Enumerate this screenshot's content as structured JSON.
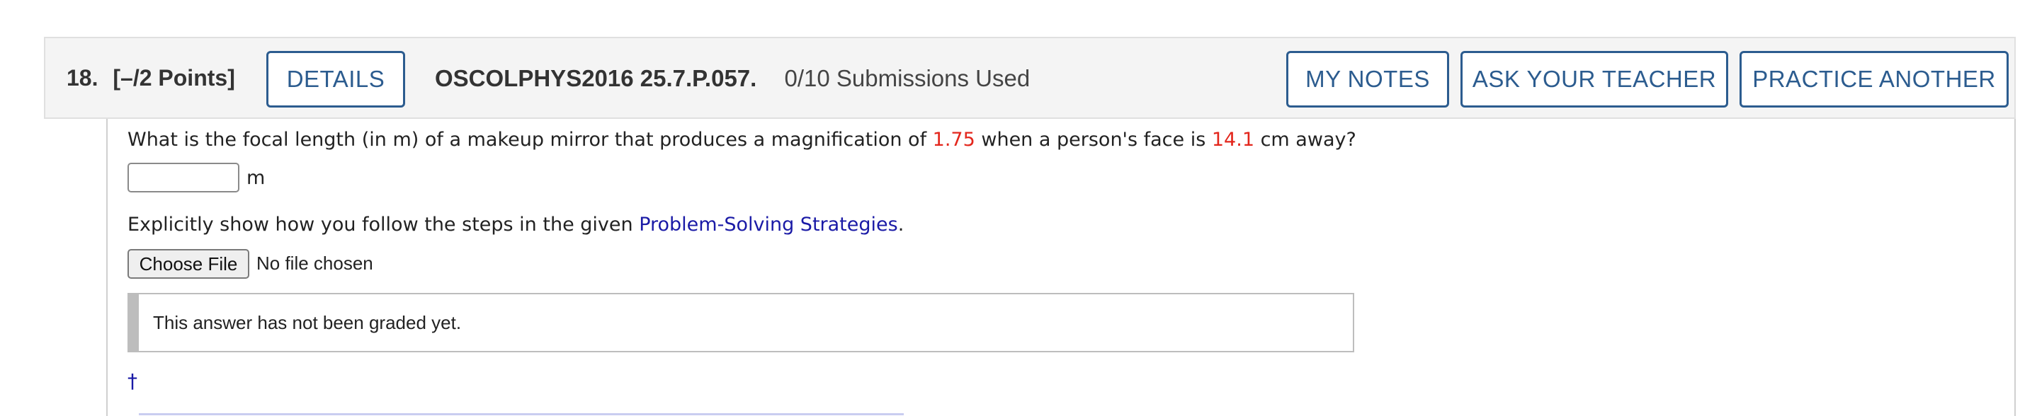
{
  "header": {
    "question_number": "18.",
    "points": "[–/2 Points]",
    "details_label": "DETAILS",
    "question_code": "OSCOLPHYS2016 25.7.P.057.",
    "submissions": "0/10 Submissions Used",
    "my_notes_label": "MY NOTES",
    "ask_teacher_label": "ASK YOUR TEACHER",
    "practice_label": "PRACTICE ANOTHER"
  },
  "question": {
    "text_part1": "What is the focal length (in m) of a makeup mirror that produces a magnification of ",
    "magnification": "1.75",
    "text_part2": " when a person's face is ",
    "distance": "14.1",
    "text_part3": " cm away?",
    "answer_value": "",
    "unit": "m"
  },
  "explain": {
    "text_before": "Explicitly show how you follow the steps in the given ",
    "link_text": "Problem-Solving Strategies",
    "text_after": "."
  },
  "file_upload": {
    "button_label": "Choose File",
    "status": "No file chosen"
  },
  "grading": {
    "message": "This answer has not been graded yet."
  },
  "footnote": {
    "dagger": "†"
  },
  "colors": {
    "accent_blue": "#2c5c8f",
    "value_red": "#e3261c",
    "link_blue": "#1a1aa6"
  }
}
